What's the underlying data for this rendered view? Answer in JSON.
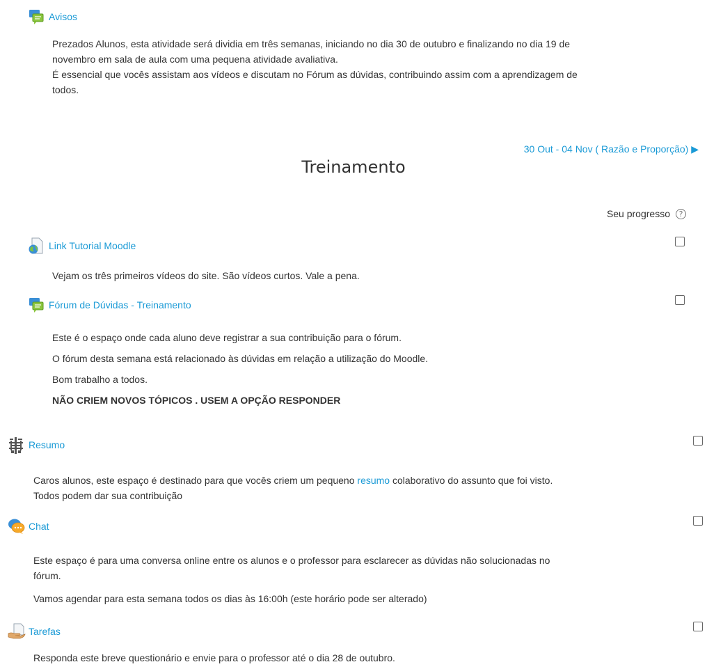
{
  "avisos": {
    "title": "Avisos",
    "icon": "forum-icon",
    "lines": [
      "Prezados Alunos, esta atividade será dividia em três semanas, iniciando no dia 30 de outubro e finalizando no dia 19 de",
      "novembro em sala de aula com uma pequena atividade avaliativa.",
      "É essencial que vocês assistam aos vídeos e discutam no Fórum as dúvidas, contribuindo assim com a aprendizagem de",
      "todos."
    ]
  },
  "nav": {
    "next_section": "30 Out - 04 Nov ( Razão e Proporção)",
    "arrow": "▶"
  },
  "section": {
    "title": "Treinamento"
  },
  "progress": {
    "label": "Seu progresso",
    "help": "?"
  },
  "activities": [
    {
      "title": "Link Tutorial Moodle",
      "icon": "url-icon",
      "lines": [
        "Vejam os três primeiros vídeos do site. São vídeos curtos. Vale a pena."
      ]
    },
    {
      "title": "Fórum de Dúvidas - Treinamento",
      "icon": "forum-icon",
      "lines": [
        "Este é o espaço onde cada aluno deve registrar a sua contribuição para o fórum.",
        "O fórum desta semana está relacionado às dúvidas em relação a utilização do Moodle.",
        "Bom trabalho a todos."
      ],
      "bold_line": "NÃO CRIEM NOVOS TÓPICOS . USEM A OPÇÃO RESPONDER"
    },
    {
      "title": "Resumo",
      "icon": "wiki-icon",
      "line1_before": "Caros alunos, este espaço é destinado para que vocês criem um pequeno ",
      "line1_link": "resumo",
      "line1_after": " colaborativo do assunto que foi visto.",
      "line2": "Todos podem dar sua contribuição"
    },
    {
      "title": "Chat",
      "icon": "chat-icon",
      "lines": [
        "Este espaço é para uma conversa online entre os alunos e o professor para esclarecer as dúvidas não solucionadas no",
        "fórum."
      ],
      "extra": "Vamos agendar para esta semana todos os dias às 16:00h (este horário pode ser alterado)"
    },
    {
      "title": "Tarefas",
      "icon": "assignment-icon",
      "lines": [
        "Responda este breve questionário e envie para o professor até o dia 28 de outubro."
      ]
    }
  ]
}
